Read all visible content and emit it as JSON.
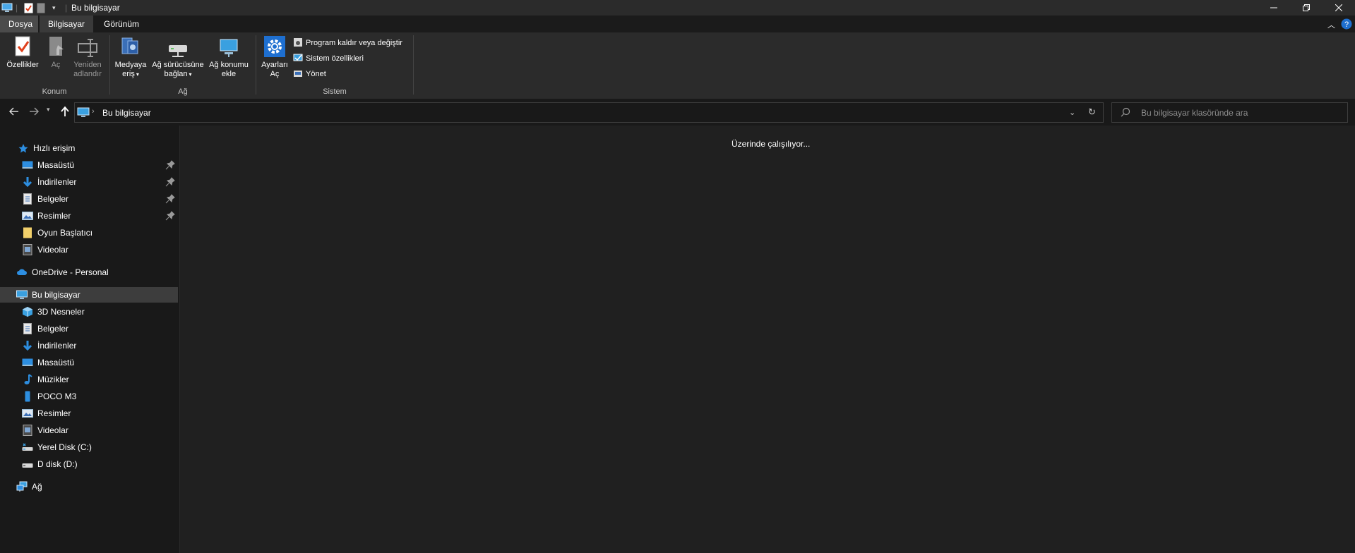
{
  "window": {
    "title": "Bu bilgisayar"
  },
  "ribbon_tabs": [
    {
      "label": "Dosya"
    },
    {
      "label": "Bilgisayar"
    },
    {
      "label": "Görünüm"
    }
  ],
  "ribbon": {
    "groups": [
      {
        "label": "Konum",
        "buttons": [
          {
            "label": "Özellikler",
            "icon": "properties-icon"
          },
          {
            "label": "Aç",
            "icon": "open-icon"
          },
          {
            "label_line1": "Yeniden",
            "label_line2": "adlandır",
            "icon": "rename-icon"
          }
        ]
      },
      {
        "label": "Ağ",
        "buttons": [
          {
            "label_line1": "Medyaya",
            "label_line2": "eriş",
            "icon": "media-access-icon"
          },
          {
            "label_line1": "Ağ sürücüsüne",
            "label_line2": "bağlan",
            "icon": "map-network-drive-icon"
          },
          {
            "label_line1": "Ağ konumu",
            "label_line2": "ekle",
            "icon": "add-network-location-icon"
          }
        ]
      },
      {
        "label": "Sistem",
        "buttons": [
          {
            "label_line1": "Ayarları",
            "label_line2": "Aç",
            "icon": "settings-icon"
          }
        ],
        "small_buttons": [
          {
            "label": "Program kaldır veya değiştir",
            "icon": "uninstall-icon"
          },
          {
            "label": "Sistem özellikleri",
            "icon": "system-properties-icon"
          },
          {
            "label": "Yönet",
            "icon": "manage-icon"
          }
        ]
      }
    ]
  },
  "address": {
    "path": "Bu bilgisayar"
  },
  "search": {
    "placeholder": "Bu bilgisayar klasöründe ara"
  },
  "nav": {
    "quick_access": "Hızlı erişim",
    "quick_items": [
      {
        "label": "Masaüstü",
        "pinned": true
      },
      {
        "label": "İndirilenler",
        "pinned": true
      },
      {
        "label": "Belgeler",
        "pinned": true
      },
      {
        "label": "Resimler",
        "pinned": true
      },
      {
        "label": "Oyun Başlatıcı",
        "pinned": false
      },
      {
        "label": "Videolar",
        "pinned": false
      }
    ],
    "onedrive": "OneDrive - Personal",
    "this_pc": "Bu bilgisayar",
    "pc_items": [
      {
        "label": "3D Nesneler"
      },
      {
        "label": "Belgeler"
      },
      {
        "label": "İndirilenler"
      },
      {
        "label": "Masaüstü"
      },
      {
        "label": "Müzikler"
      },
      {
        "label": "POCO M3"
      },
      {
        "label": "Resimler"
      },
      {
        "label": "Videolar"
      },
      {
        "label": "Yerel Disk (C:)"
      },
      {
        "label": "D disk (D:)"
      }
    ],
    "network": "Ağ"
  },
  "content": {
    "status": "Üzerinde çalışılıyor..."
  },
  "colors": {
    "accent": "#0078d7",
    "background": "#191919",
    "content_bg": "#202020"
  }
}
